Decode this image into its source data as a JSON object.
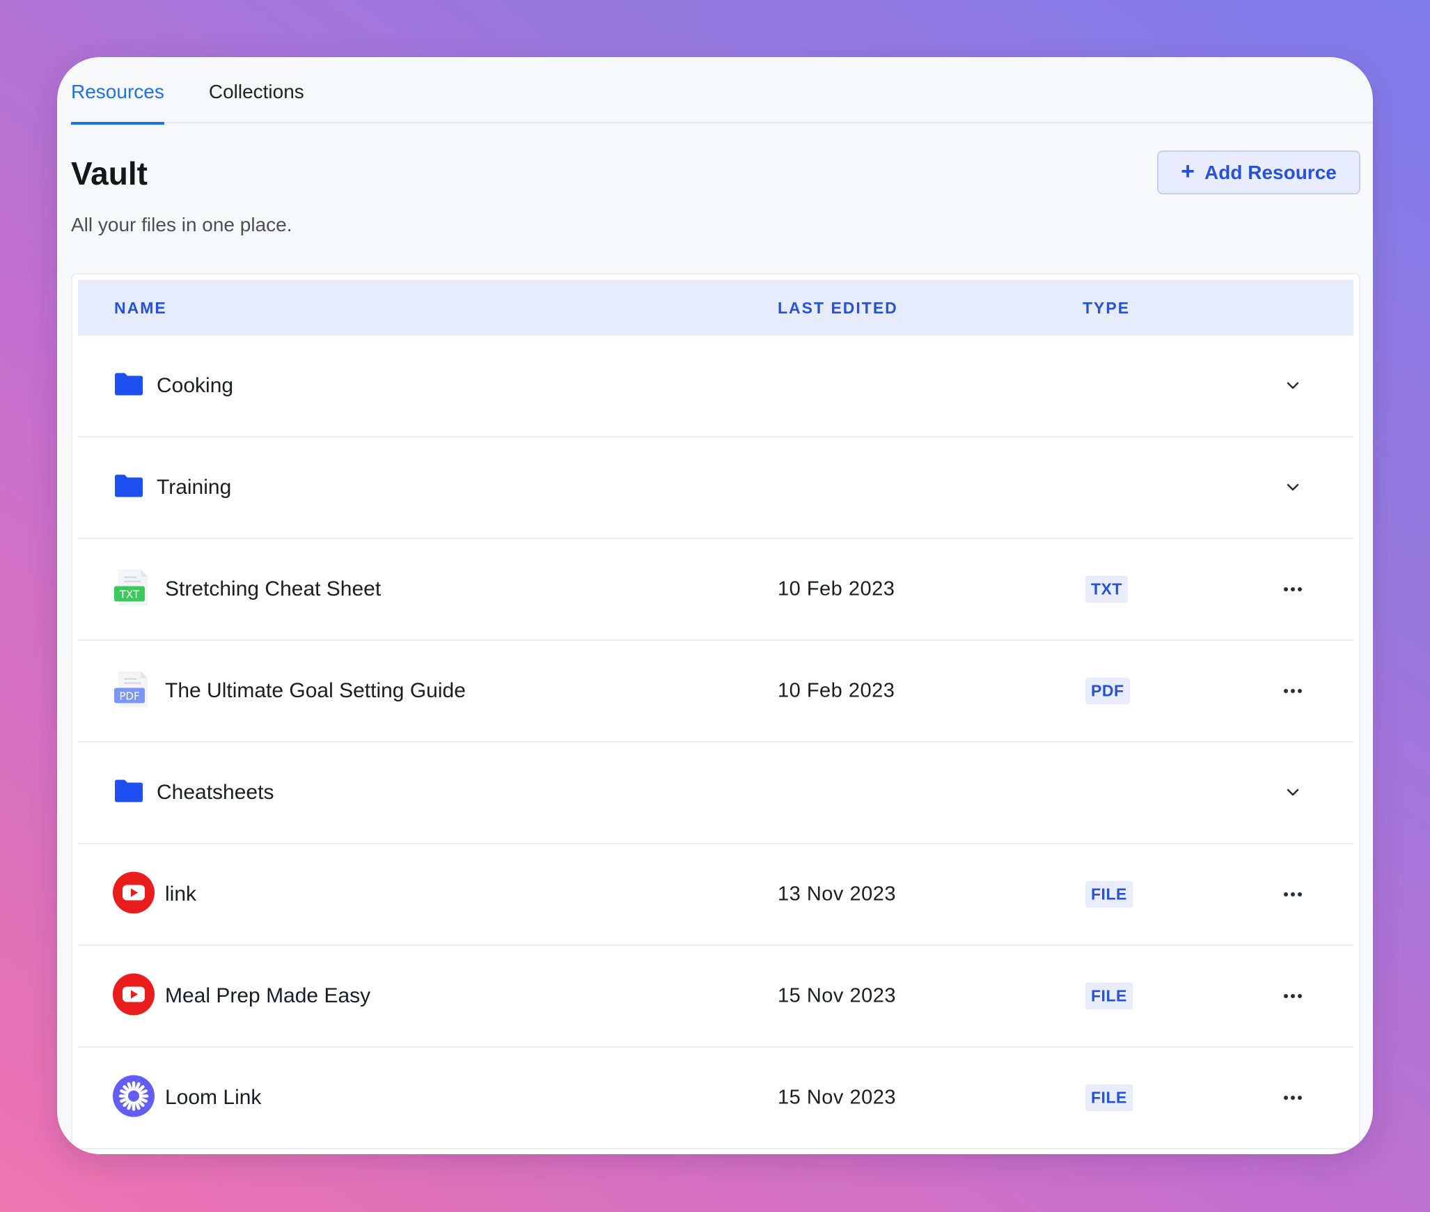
{
  "tabs": [
    {
      "label": "Resources",
      "active": true
    },
    {
      "label": "Collections",
      "active": false
    }
  ],
  "header": {
    "title": "Vault",
    "subtitle": "All your files in one place.",
    "add_button": "Add Resource"
  },
  "table": {
    "columns": {
      "name": "NAME",
      "last_edited": "LAST EDITED",
      "type": "TYPE"
    },
    "rows": [
      {
        "kind": "folder",
        "icon": "folder-icon",
        "name": "Cooking",
        "date": "",
        "type": "",
        "action": "chevron-down-icon"
      },
      {
        "kind": "folder",
        "icon": "folder-icon",
        "name": "Training",
        "date": "",
        "type": "",
        "action": "chevron-down-icon"
      },
      {
        "kind": "file",
        "icon": "txt-file-icon",
        "icon_label": "TXT",
        "name": "Stretching Cheat Sheet",
        "date": "10 Feb 2023",
        "type": "TXT",
        "action": "more-options-icon"
      },
      {
        "kind": "file",
        "icon": "pdf-file-icon",
        "icon_label": "PDF",
        "name": "The Ultimate Goal Setting Guide",
        "date": "10 Feb 2023",
        "type": "PDF",
        "action": "more-options-icon"
      },
      {
        "kind": "folder",
        "icon": "folder-icon",
        "name": "Cheatsheets",
        "date": "",
        "type": "",
        "action": "chevron-down-icon"
      },
      {
        "kind": "file",
        "icon": "youtube-icon",
        "name": "link",
        "date": "13 Nov 2023",
        "type": "FILE",
        "action": "more-options-icon"
      },
      {
        "kind": "file",
        "icon": "youtube-icon",
        "name": "Meal Prep Made Easy",
        "date": "15 Nov 2023",
        "type": "FILE",
        "action": "more-options-icon"
      },
      {
        "kind": "file",
        "icon": "loom-icon",
        "name": "Loom Link",
        "date": "15 Nov 2023",
        "type": "FILE",
        "action": "more-options-icon"
      }
    ]
  },
  "colors": {
    "accent": "#1a73e8",
    "button_text": "#2552d9",
    "folder": "#1f4ff0",
    "youtube": "#ea1d1d",
    "loom": "#625df5",
    "txt": "#3cc85c",
    "pdf": "#7c97f2"
  }
}
